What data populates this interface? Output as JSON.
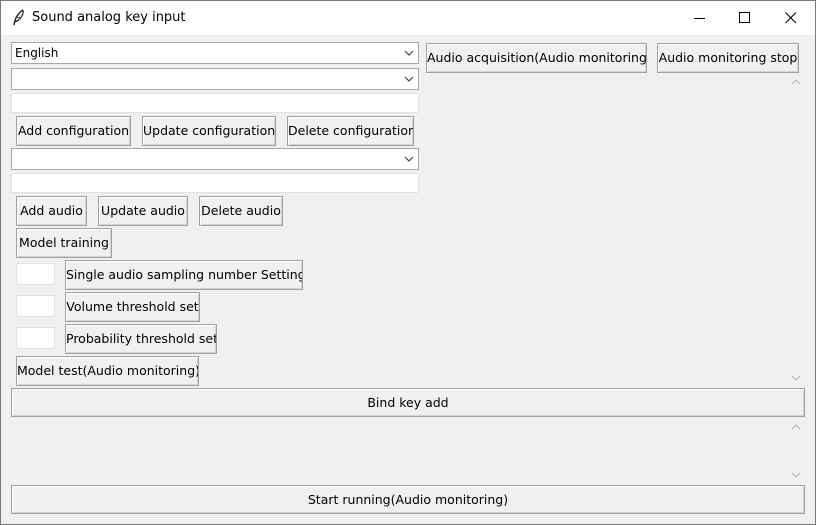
{
  "window": {
    "title": "Sound analog key input",
    "icon": "feather-icon",
    "controls": [
      "minimize-icon",
      "maximize-icon",
      "close-icon"
    ]
  },
  "language_select": {
    "value": "English"
  },
  "config_select": {
    "value": ""
  },
  "config_name_input": {
    "value": ""
  },
  "config_buttons": {
    "add": "Add configuration",
    "update": "Update configuration",
    "delete": "Delete configuration"
  },
  "audio_select": {
    "value": ""
  },
  "audio_name_input": {
    "value": ""
  },
  "audio_buttons": {
    "add": "Add audio",
    "update": "Update audio",
    "delete": "Delete audio"
  },
  "model_training_label": "Model training",
  "sampling": {
    "value": "",
    "label": "Single audio sampling number Settings"
  },
  "volume_threshold": {
    "value": "",
    "label": "Volume threshold set"
  },
  "probability_threshold": {
    "value": "",
    "label": "Probability threshold set"
  },
  "model_test_label": "Model test(Audio monitoring)",
  "audio_acquisition_label": "Audio acquisition(Audio monitoring)",
  "audio_monitoring_stop_label": "Audio monitoring stop",
  "bind_key_add_label": "Bind key add",
  "start_running_label": "Start running(Audio monitoring)"
}
